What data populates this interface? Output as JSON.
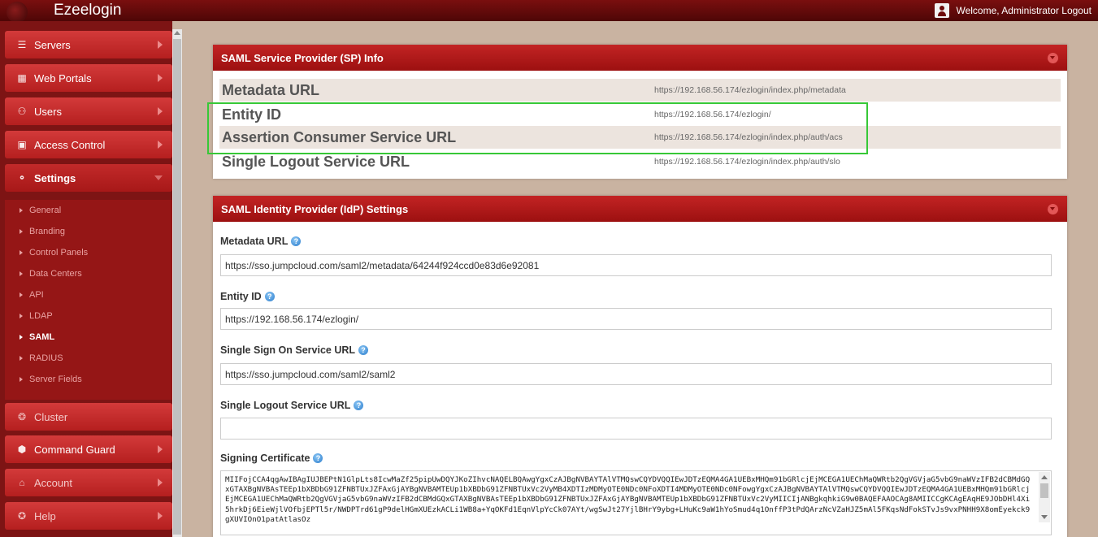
{
  "app": {
    "brand": "Ezeelogin",
    "welcome": "Welcome, Administrator Logout"
  },
  "sidebar": {
    "items": [
      {
        "label": "Servers",
        "icon": "list-icon"
      },
      {
        "label": "Web Portals",
        "icon": "grid-icon"
      },
      {
        "label": "Users",
        "icon": "users-icon"
      },
      {
        "label": "Access Control",
        "icon": "briefcase-icon"
      },
      {
        "label": "Settings",
        "icon": "settings-icon"
      },
      {
        "label": "Cluster",
        "icon": "cluster-icon"
      },
      {
        "label": "Command Guard",
        "icon": "shield-icon"
      },
      {
        "label": "Account",
        "icon": "home-icon"
      },
      {
        "label": "Help",
        "icon": "help-icon"
      }
    ],
    "submenu": [
      "General",
      "Branding",
      "Control Panels",
      "Data Centers",
      "API",
      "LDAP",
      "SAML",
      "RADIUS",
      "Server Fields"
    ],
    "active_sub": "SAML"
  },
  "sp_panel": {
    "title": "SAML Service Provider (SP) Info",
    "rows": [
      {
        "label": "Metadata URL",
        "value": "https://192.168.56.174/ezlogin/index.php/metadata"
      },
      {
        "label": "Entity ID",
        "value": "https://192.168.56.174/ezlogin/"
      },
      {
        "label": "Assertion Consumer Service URL",
        "value": "https://192.168.56.174/ezlogin/index.php/auth/acs"
      },
      {
        "label": "Single Logout Service URL",
        "value": "https://192.168.56.174/ezlogin/index.php/auth/slo"
      }
    ]
  },
  "idp_panel": {
    "title": "SAML Identity Provider (IdP) Settings",
    "fields": [
      {
        "label": "Metadata URL",
        "value": "https://sso.jumpcloud.com/saml2/metadata/64244f924ccd0e83d6e92081"
      },
      {
        "label": "Entity ID",
        "value": "https://192.168.56.174/ezlogin/"
      },
      {
        "label": "Single Sign On Service URL",
        "value": "https://sso.jumpcloud.com/saml2/saml2"
      },
      {
        "label": "Single Logout Service URL",
        "value": ""
      }
    ],
    "cert_label": "Signing Certificate",
    "cert_value": "MIIFojCCA4qgAwIBAgIUJBEPtN1GlpLts8IcwMaZf25pipUwDQYJKoZIhvcNAQELBQAwgYgxCzAJBgNVBAYTAlVTMQswCQYDVQQIEwJDTzEQMA4GA1UEBxMHQm91bGRlcjEjMCEGA1UEChMaQWRtb2QgVGVjaG5vbG9naWVzIFB2dCBMdGQxGTAXBgNVBAsTEEp1bXBDbG91ZFNBTUxJZFAxGjAYBgNVBAMTEUp1bXBDbG91ZFNBTUxVc2VyMB4XDTIzMDMyOTE0NDc0NFoXDTI4MDMyOTE0NDc0NFowgYgxCzAJBgNVBAYTAlVTMQswCQYDVQQIEwJDTzEQMA4GA1UEBxMHQm91bGRlcjEjMCEGA1UEChMaQWRtb2QgVGVjaG5vbG9naWVzIFB2dCBMdGQxGTAXBgNVBAsTEEp1bXBDbG91ZFNBTUxJZFAxGjAYBgNVBAMTEUp1bXBDbG91ZFNBTUxVc2VyMIICIjANBgkqhkiG9w0BAQEFAAOCAg8AMIICCgKCAgEAqHE9JObDHl4Xi5hrkDj6EieWjlVOfbjEPTl5r/NWDPTrd61gP9delHGmXUEzkACLi1WB8a+YqOKFd1EqnVlpYcCk07AYt/wgSwJt27YjlBHrY9ybg+LHuKc9aW1hYoSmud4q1OnffP3tPdQArzNcVZaHJZ5mAl5FKqsNdFokSTvJs9vxPNHH9X8omEyekck9gXUVIOnO1patAtlasOz"
  }
}
